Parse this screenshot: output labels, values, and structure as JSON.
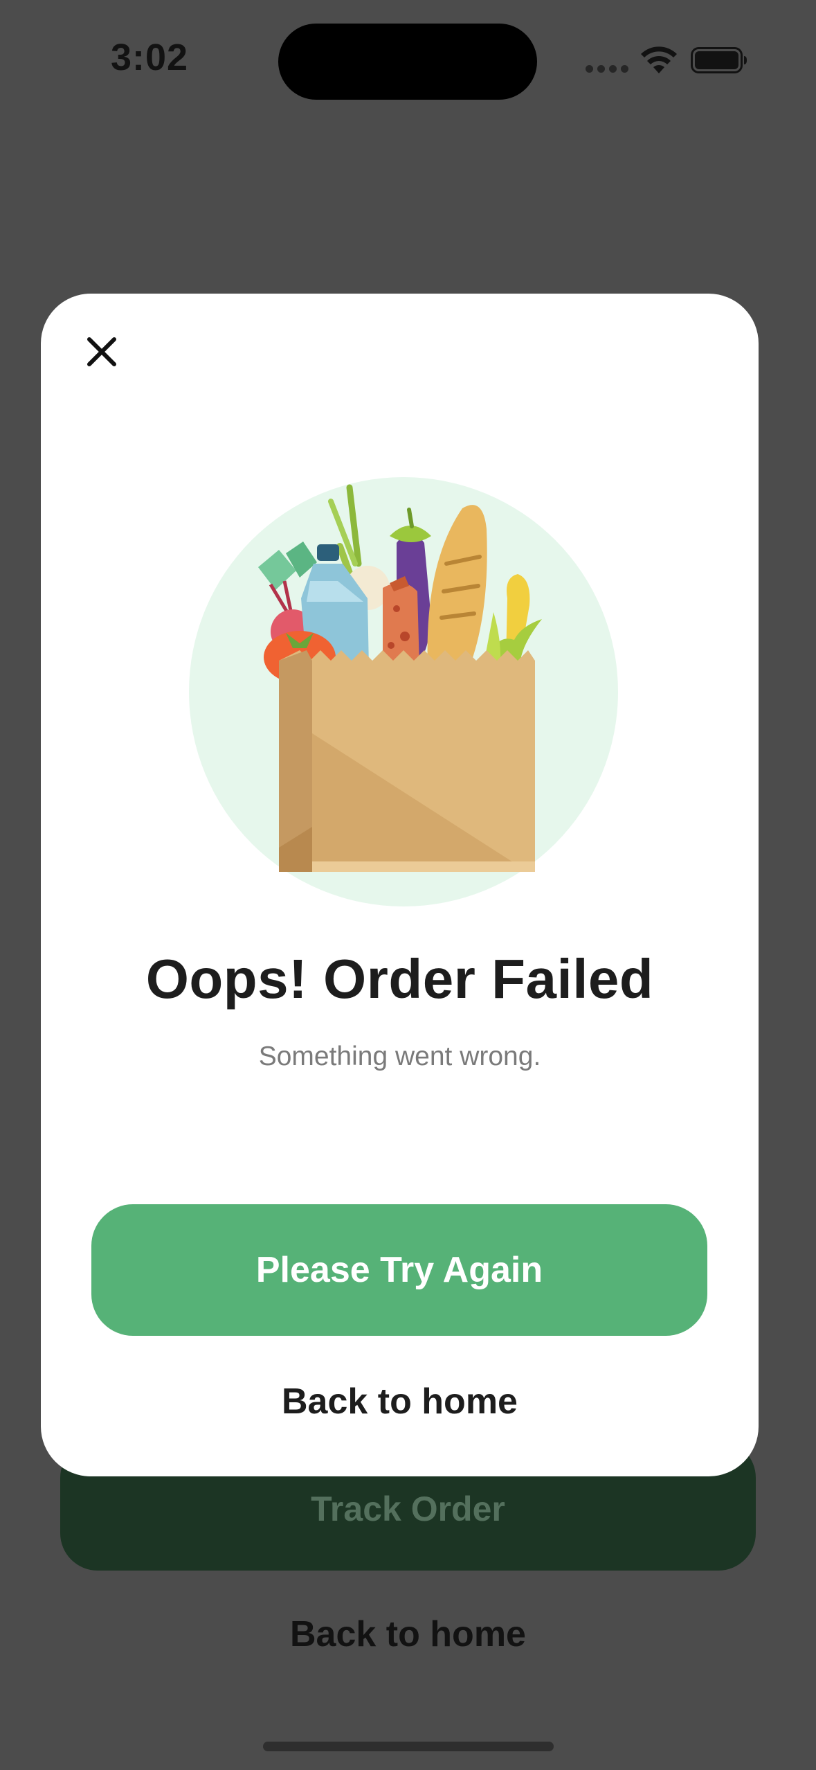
{
  "status_bar": {
    "time": "3:02",
    "icons": [
      "cellular-signal-icon",
      "wifi-icon",
      "battery-icon"
    ]
  },
  "background_page": {
    "track_order_label": "Track Order",
    "back_home_label": "Back to home"
  },
  "modal": {
    "close_icon": "close-icon",
    "illustration": "grocery-bag-illustration",
    "title": "Oops! Order Failed",
    "subtitle": "Something went wrong.",
    "primary_button_label": "Please Try Again",
    "secondary_link_label": "Back to home"
  },
  "colors": {
    "overlay_background": "#4c4c4c",
    "modal_background": "#ffffff",
    "primary_green": "#56b277",
    "dark_green": "#1c3524",
    "illustration_circle": "#e6f7ec",
    "bag": "#dfb87c"
  }
}
